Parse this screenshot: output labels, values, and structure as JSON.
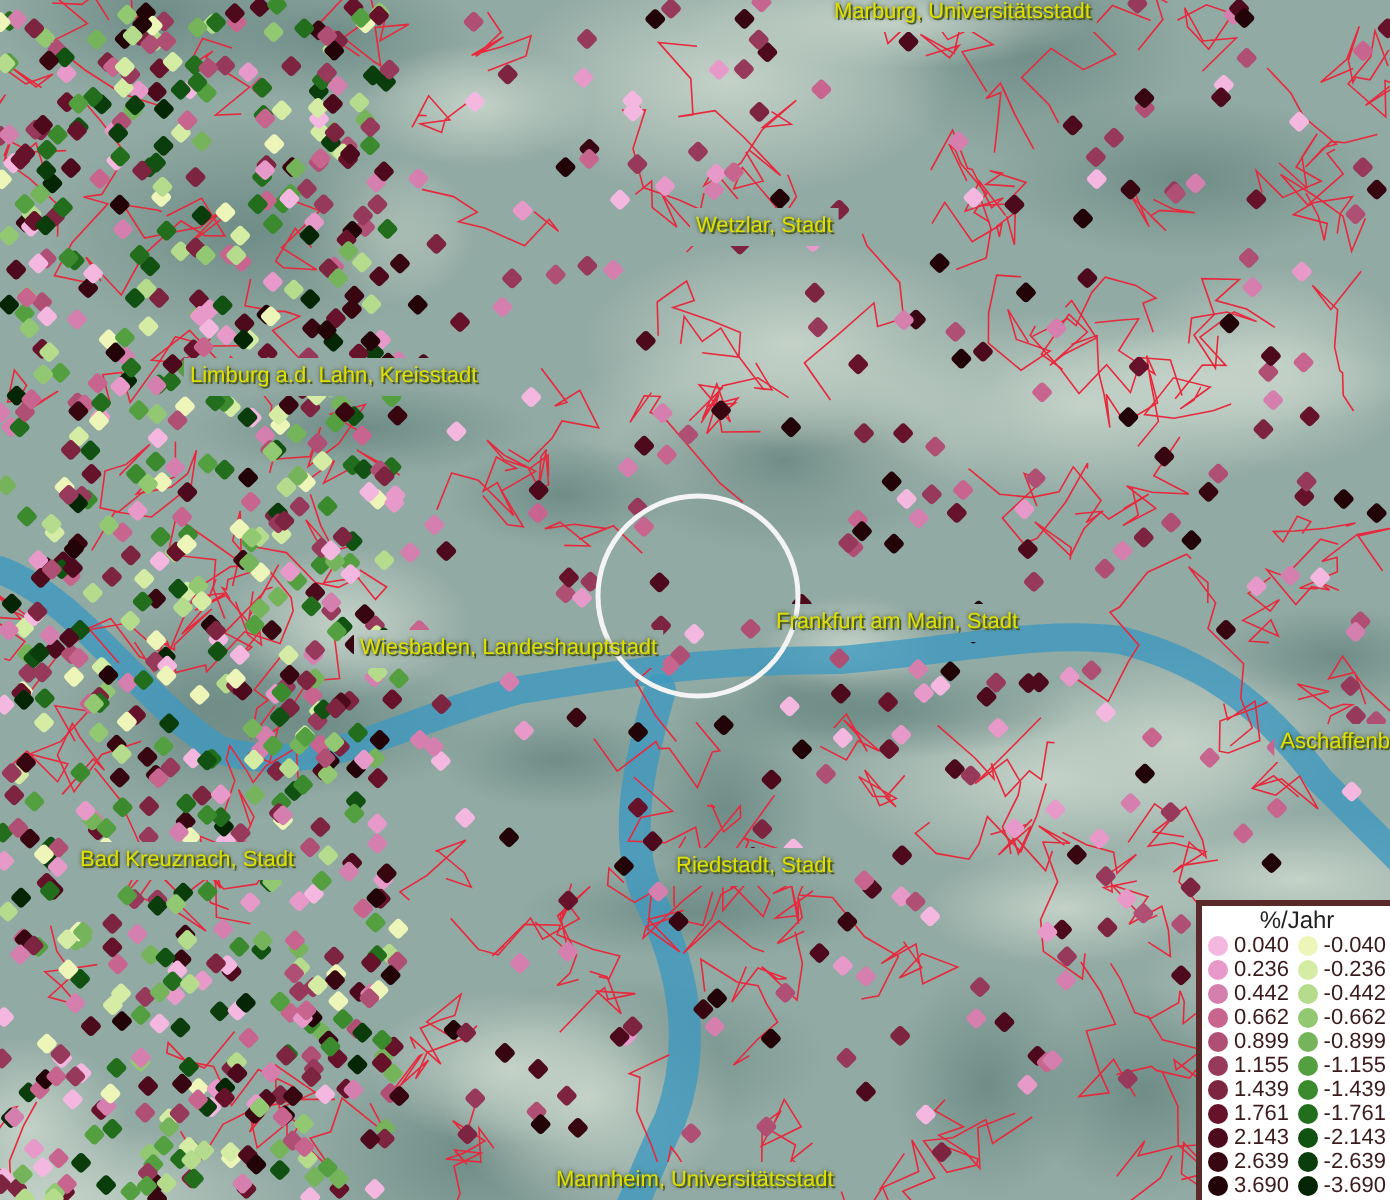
{
  "map": {
    "place_labels": [
      {
        "text": "Marburg, Universitätsstadt"
      },
      {
        "text": "Wetzlar, Stadt"
      },
      {
        "text": "Limburg a.d. Lahn, Kreisstadt"
      },
      {
        "text": "Frankfurt am Main, Stadt"
      },
      {
        "text": "Wiesbaden, Landeshauptstadt"
      },
      {
        "text": "Aschaffenb"
      },
      {
        "text": "Bad Kreuznach, Stadt"
      },
      {
        "text": "Riedstadt, Stadt"
      },
      {
        "text": "Mannheim, Universitätsstadt"
      }
    ]
  },
  "legend": {
    "title": "%/Jahr",
    "positive": [
      {
        "label": "0.040",
        "color": "#f4b8e0"
      },
      {
        "label": "0.236",
        "color": "#e79ac9"
      },
      {
        "label": "0.442",
        "color": "#d57fae"
      },
      {
        "label": "0.662",
        "color": "#c7658f"
      },
      {
        "label": "0.899",
        "color": "#b04f74"
      },
      {
        "label": "1.155",
        "color": "#96395a"
      },
      {
        "label": "1.439",
        "color": "#7d2540"
      },
      {
        "label": "1.761",
        "color": "#66122a"
      },
      {
        "label": "2.143",
        "color": "#4d0a1c"
      },
      {
        "label": "2.639",
        "color": "#380611"
      },
      {
        "label": "3.690",
        "color": "#220308"
      }
    ],
    "negative": [
      {
        "label": "-0.040",
        "color": "#eef5b8"
      },
      {
        "label": "-0.236",
        "color": "#d5eca5"
      },
      {
        "label": "-0.442",
        "color": "#b4dc8c"
      },
      {
        "label": "-0.662",
        "color": "#93c873"
      },
      {
        "label": "-0.899",
        "color": "#76b45c"
      },
      {
        "label": "-1.155",
        "color": "#54a040"
      },
      {
        "label": "-1.439",
        "color": "#3b8a2e"
      },
      {
        "label": "-1.761",
        "color": "#226e1c"
      },
      {
        "label": "-2.143",
        "color": "#115212"
      },
      {
        "label": "-2.639",
        "color": "#0a3d0b"
      },
      {
        "label": "-3.690",
        "color": "#052605"
      }
    ]
  }
}
